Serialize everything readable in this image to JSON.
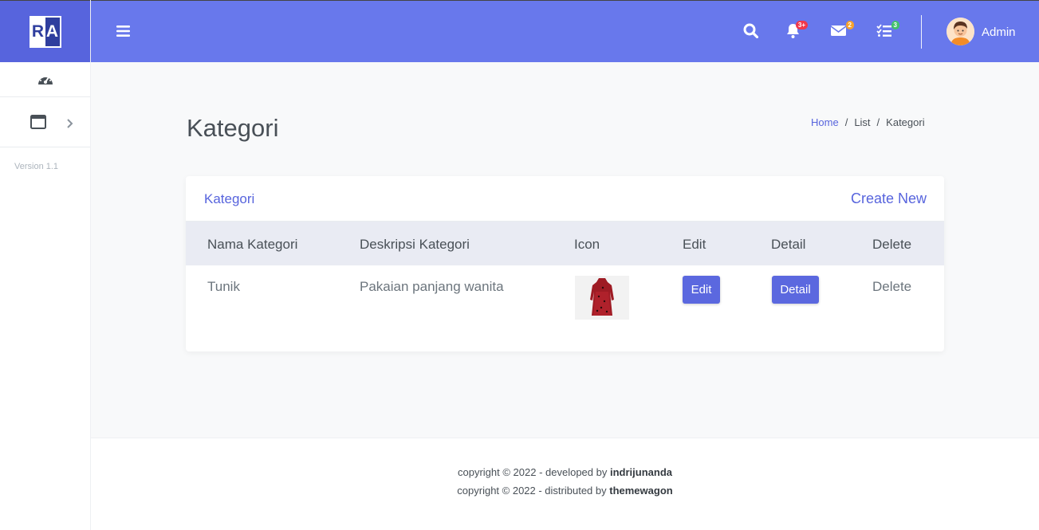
{
  "brand": {
    "logo_left": "R",
    "logo_right": "A"
  },
  "sidebar": {
    "items": [
      {
        "icon": "dashboard-gauge-icon"
      },
      {
        "icon": "window-icon",
        "expand_icon": "chevron-right-icon"
      }
    ],
    "version": "Version 1.1"
  },
  "topbar": {
    "notifications_badge": "3+",
    "messages_badge": "2",
    "tasks_badge": "3",
    "user_name": "Admin"
  },
  "page": {
    "title": "Kategori",
    "breadcrumb": [
      "Home",
      "/",
      "List",
      "/",
      "Kategori"
    ]
  },
  "card": {
    "title": "Kategori",
    "create_new": "Create New",
    "columns": [
      "Nama Kategori",
      "Deskripsi Kategori",
      "Icon",
      "Edit",
      "Detail",
      "Delete"
    ],
    "rows": [
      {
        "nama": "Tunik",
        "deskripsi": "Pakaian panjang wanita",
        "edit": "Edit",
        "detail": "Detail",
        "delete": "Delete"
      }
    ]
  },
  "footer": {
    "line1_prefix": "copyright © 2022 - developed by ",
    "line1_name": "indrijunanda",
    "line2_prefix": "copyright © 2022 - distributed by ",
    "line2_name": "themewagon"
  },
  "colors": {
    "primary": "#6878ec",
    "accent": "#5764dd",
    "badge_red": "#f0384a",
    "badge_orange": "#f7a22b",
    "badge_green": "#42c26a"
  }
}
